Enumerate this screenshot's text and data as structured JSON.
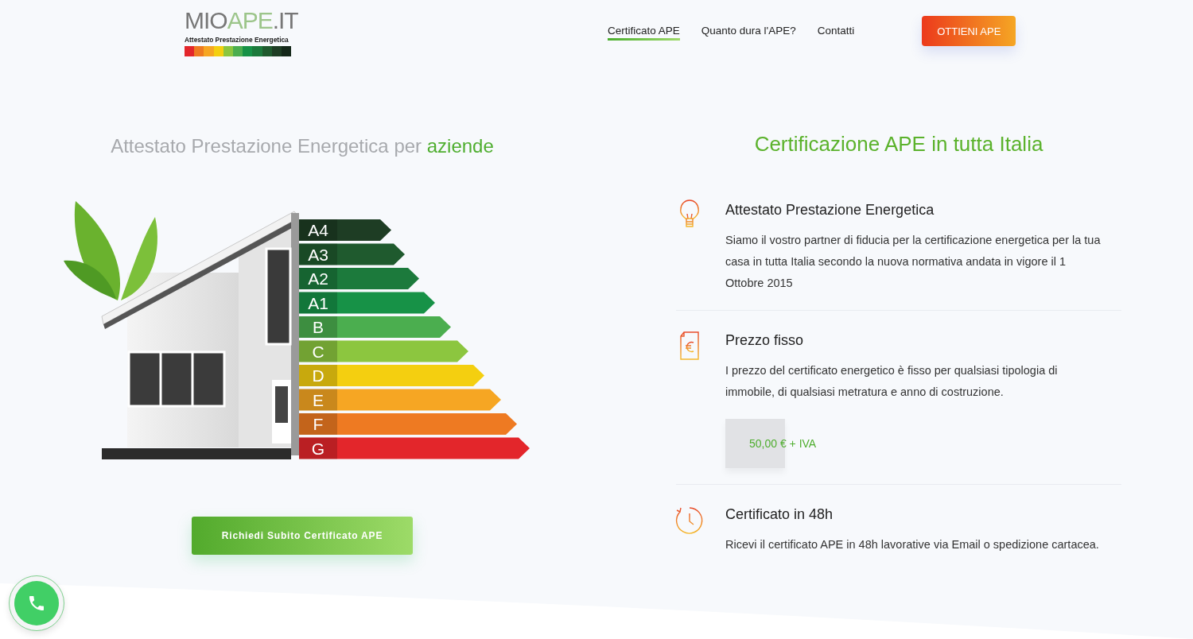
{
  "logo": {
    "wordmark": [
      "MIO",
      "APE",
      ".IT"
    ],
    "tagline": "Attestato Prestazione Energetica"
  },
  "nav": {
    "items": [
      {
        "label": "Certificato APE",
        "selected": true
      },
      {
        "label": "Quanto dura l'APE?",
        "selected": false
      },
      {
        "label": "Contatti",
        "selected": false
      }
    ],
    "cta": "OTTIENI APE"
  },
  "hero": {
    "headline": "Attestato Prestazione Energetica per **aziende**",
    "energy_classes": [
      {
        "label": "A4",
        "color": "#1e3d24"
      },
      {
        "label": "A3",
        "color": "#1f5a2e"
      },
      {
        "label": "A2",
        "color": "#1c7a3c"
      },
      {
        "label": "A1",
        "color": "#179247"
      },
      {
        "label": "B",
        "color": "#4bae4f"
      },
      {
        "label": "C",
        "color": "#8cc63f"
      },
      {
        "label": "D",
        "color": "#f4cf10"
      },
      {
        "label": "E",
        "color": "#f6a623"
      },
      {
        "label": "F",
        "color": "#ee7a22"
      },
      {
        "label": "G",
        "color": "#e3262b"
      }
    ],
    "button": "Richiedi Subito Certificato APE"
  },
  "services": {
    "title": "Certificazione APE in tutta Italia",
    "items": [
      {
        "kind": "bulb",
        "title": "Attestato Prestazione Energetica",
        "text": "Siamo il vostro partner di fiducia per la certificazione energetica per la tua casa in tutta Italia secondo la nuova normativa andata in vigore il 1 Ottobre 2015"
      },
      {
        "kind": "euro-document",
        "title": "Prezzo fisso",
        "text": "I prezzo del certificato energetico è fisso per qualsiasi tipologia di immobile, di qualsiasi metratura e anno di costruzione.",
        "price": "50,00 € + IVA"
      },
      {
        "kind": "clock",
        "title": "Certificato in 48h",
        "text": "Ricevi il certificato APE in 48h lavorative via Email o spedizione cartacea."
      }
    ]
  }
}
